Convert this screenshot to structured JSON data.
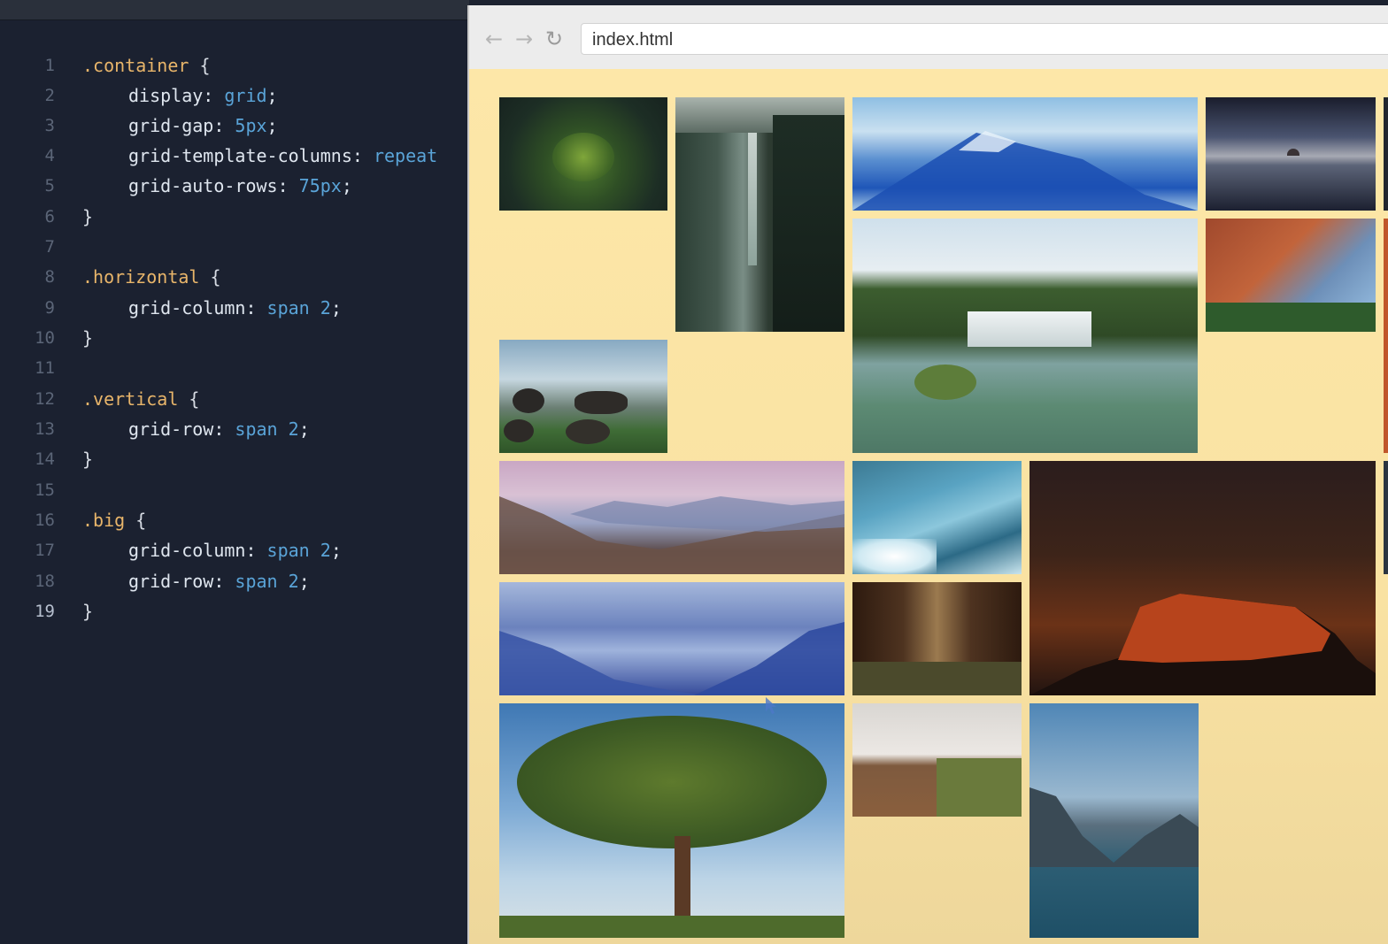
{
  "editor": {
    "lines": [
      {
        "n": "1"
      },
      {
        "n": "2"
      },
      {
        "n": "3"
      },
      {
        "n": "4"
      },
      {
        "n": "5"
      },
      {
        "n": "6"
      },
      {
        "n": "7"
      },
      {
        "n": "8"
      },
      {
        "n": "9"
      },
      {
        "n": "10"
      },
      {
        "n": "11"
      },
      {
        "n": "12"
      },
      {
        "n": "13"
      },
      {
        "n": "14"
      },
      {
        "n": "15"
      },
      {
        "n": "16"
      },
      {
        "n": "17"
      },
      {
        "n": "18"
      },
      {
        "n": "19"
      }
    ],
    "active_line": "19",
    "code": {
      "l1_sel": ".container",
      "open": "{",
      "close": "}",
      "l2_prop": "display:",
      "l2_val": "grid",
      "l3_prop": "grid-gap:",
      "l3_val": "5px",
      "l4_prop": "grid-template-columns:",
      "l4_val": "repeat",
      "l5_prop": "grid-auto-rows:",
      "l5_val": "75px",
      "l8_sel": ".horizontal",
      "l9_prop": "grid-column:",
      "l9_val": "span",
      "l9_num": "2",
      "l12_sel": ".vertical",
      "l13_prop": "grid-row:",
      "l13_val": "span",
      "l13_num": "2",
      "l16_sel": ".big",
      "l17_prop": "grid-column:",
      "l17_val": "span",
      "l17_num": "2",
      "l18_prop": "grid-row:",
      "l18_val": "span",
      "l18_num": "2",
      "semi": ";"
    }
  },
  "browser": {
    "address": "index.html",
    "back_icon": "←",
    "forward_icon": "→",
    "reload_icon": "↻"
  },
  "colors": {
    "page_bg": "#fde7a8",
    "editor_bg": "#1b2130",
    "selector": "#e8b56a",
    "value": "#5aa4d8"
  },
  "gallery": {
    "images": [
      {
        "name": "forest-moss-photo"
      },
      {
        "name": "waterfall-forest-photo"
      },
      {
        "name": "blue-mountain-clouds-photo"
      },
      {
        "name": "lake-sunset-photo"
      },
      {
        "name": "waterfall-lake-photo"
      },
      {
        "name": "red-rock-waterfall-photo"
      },
      {
        "name": "boulders-field-photo"
      },
      {
        "name": "pink-mountain-range-photo"
      },
      {
        "name": "river-rapids-photo"
      },
      {
        "name": "red-mesa-night-photo"
      },
      {
        "name": "blue-misty-mountains-photo"
      },
      {
        "name": "dark-forest-path-photo"
      },
      {
        "name": "big-tree-photo"
      },
      {
        "name": "field-horizon-photo"
      },
      {
        "name": "mountain-lake-reflection-photo"
      }
    ]
  }
}
